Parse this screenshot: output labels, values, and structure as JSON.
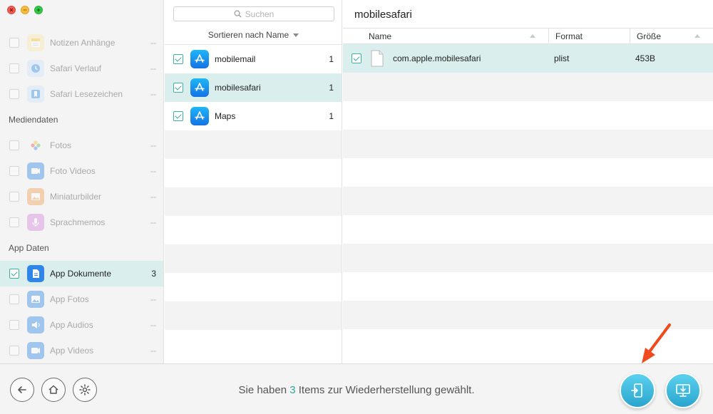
{
  "sidebar": {
    "top_items": [
      {
        "label": "Notizen Anhänge",
        "count": "--",
        "icon": "notes-icon",
        "color": "#f6d36a"
      },
      {
        "label": "Safari Verlauf",
        "count": "--",
        "icon": "safari-history-icon",
        "color": "#4a9ff0"
      },
      {
        "label": "Safari Lesezeichen",
        "count": "--",
        "icon": "safari-bookmark-icon",
        "color": "#4a9ff0"
      }
    ],
    "section_media": "Mediendaten",
    "media_items": [
      {
        "label": "Fotos",
        "count": "--",
        "icon": "photos-icon"
      },
      {
        "label": "Foto Videos",
        "count": "--",
        "icon": "photo-videos-icon"
      },
      {
        "label": "Miniaturbilder",
        "count": "--",
        "icon": "thumbnails-icon"
      },
      {
        "label": "Sprachmemos",
        "count": "--",
        "icon": "voice-memos-icon"
      }
    ],
    "section_app": "App Daten",
    "app_items": [
      {
        "label": "App Dokumente",
        "count": "3",
        "icon": "app-documents-icon",
        "selected": true
      },
      {
        "label": "App Fotos",
        "count": "--",
        "icon": "app-photos-icon"
      },
      {
        "label": "App Audios",
        "count": "--",
        "icon": "app-audios-icon"
      },
      {
        "label": "App Videos",
        "count": "--",
        "icon": "app-videos-icon"
      }
    ]
  },
  "middle": {
    "search_placeholder": "Suchen",
    "sort_label": "Sortieren nach Name",
    "apps": [
      {
        "label": "mobilemail",
        "count": "1"
      },
      {
        "label": "mobilesafari",
        "count": "1"
      },
      {
        "label": "Maps",
        "count": "1"
      }
    ]
  },
  "right": {
    "title": "mobilesafari",
    "columns": {
      "name": "Name",
      "format": "Format",
      "size": "Größe"
    },
    "files": [
      {
        "name": "com.apple.mobilesafari",
        "format": "plist",
        "size": "453B"
      }
    ]
  },
  "footer": {
    "status_prefix": "Sie haben ",
    "status_count": "3",
    "status_suffix": " Items zur Wiederherstellung gewählt.",
    "accent_color": "#2ea89e",
    "arrow_color": "#f04a1d"
  }
}
